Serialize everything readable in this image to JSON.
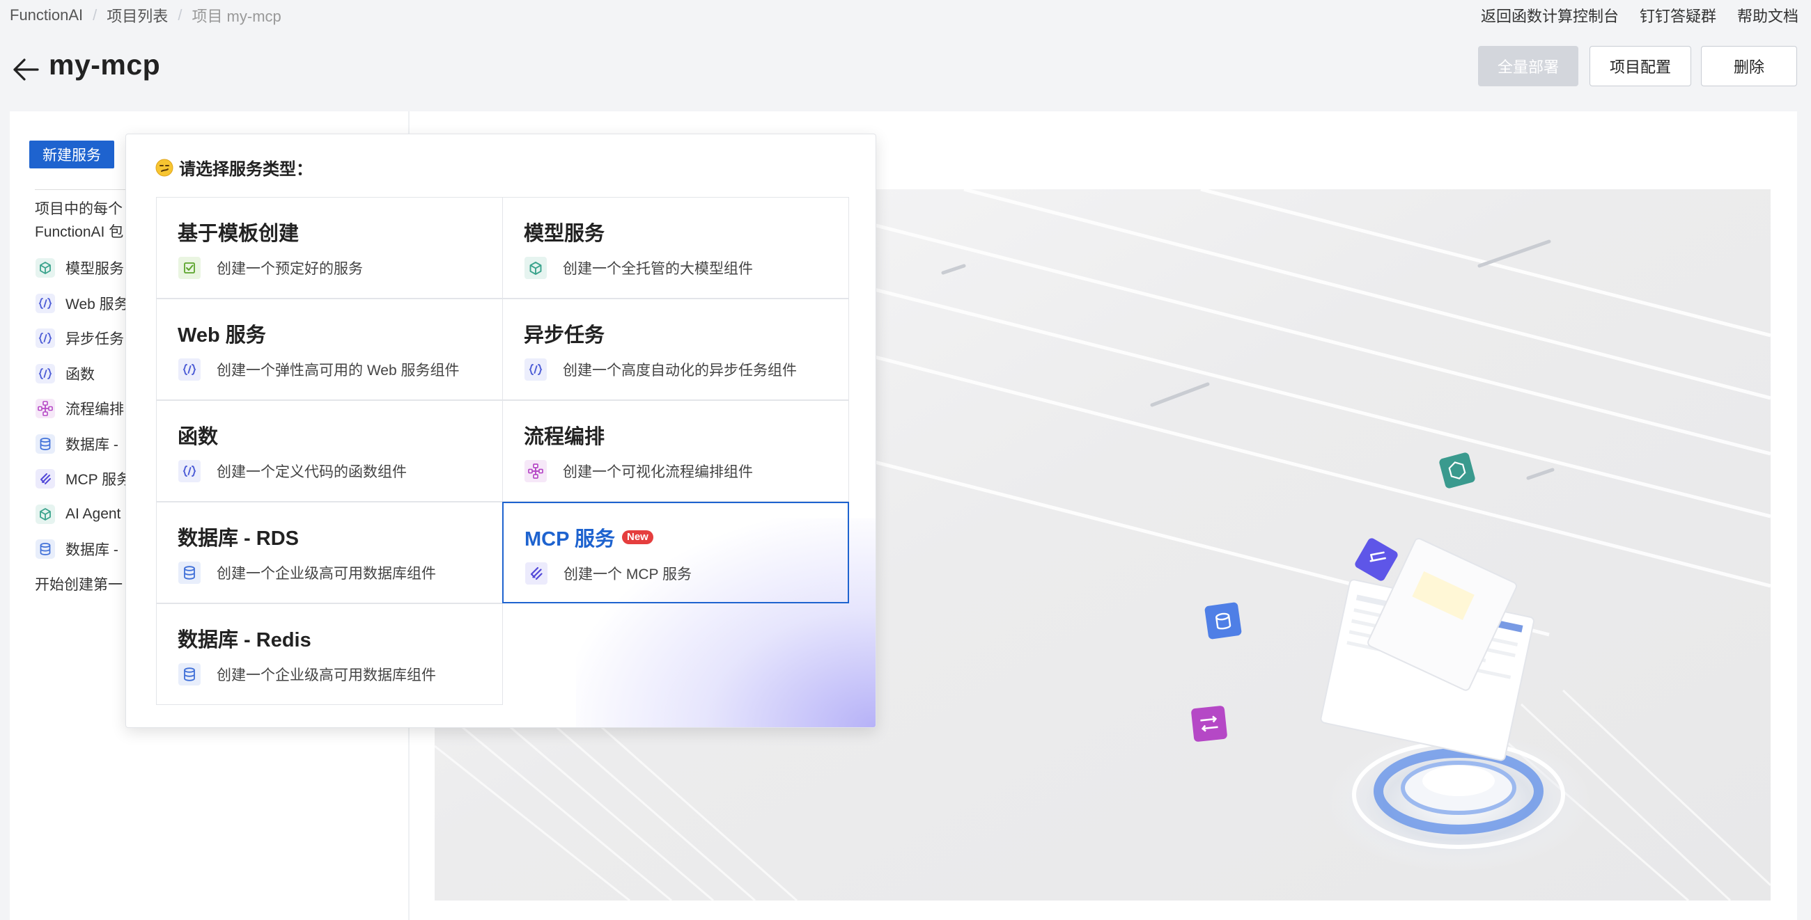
{
  "breadcrumb": {
    "root": "FunctionAI",
    "list": "项目列表",
    "current": "项目 my-mcp"
  },
  "top_links": {
    "console": "返回函数计算控制台",
    "dingtalk": "钉钉答疑群",
    "docs": "帮助文档"
  },
  "header": {
    "title": "my-mcp",
    "deploy_label": "全量部署",
    "config_label": "项目配置",
    "delete_label": "删除"
  },
  "sidebar": {
    "new_service_label": "新建服务",
    "intro_line1": "项目中的每个",
    "intro_line2": "FunctionAI 包",
    "items": [
      {
        "label": "模型服务",
        "icon": "cube-icon"
      },
      {
        "label": "Web 服务",
        "icon": "code-bracket-icon"
      },
      {
        "label": "异步任务",
        "icon": "code-bracket-icon"
      },
      {
        "label": "函数",
        "icon": "code-bracket-icon"
      },
      {
        "label": "流程编排",
        "icon": "workflow-icon"
      },
      {
        "label": "数据库 -",
        "icon": "database-icon"
      },
      {
        "label": "MCP 服务",
        "icon": "mcp-icon"
      },
      {
        "label": "AI Agent",
        "icon": "cube-icon"
      },
      {
        "label": "数据库 -",
        "icon": "database-icon"
      }
    ],
    "start_tip": "开始创建第一"
  },
  "dropdown": {
    "title": "请选择服务类型：",
    "cards": [
      {
        "title": "基于模板创建",
        "desc": "创建一个预定好的服务",
        "icon": "template-check-icon"
      },
      {
        "title": "模型服务",
        "desc": "创建一个全托管的大模型组件",
        "icon": "cube-icon"
      },
      {
        "title": "Web 服务",
        "desc": "创建一个弹性高可用的 Web 服务组件",
        "icon": "code-bracket-icon"
      },
      {
        "title": "异步任务",
        "desc": "创建一个高度自动化的异步任务组件",
        "icon": "code-bracket-icon"
      },
      {
        "title": "函数",
        "desc": "创建一个定义代码的函数组件",
        "icon": "code-bracket-icon"
      },
      {
        "title": "流程编排",
        "desc": "创建一个可视化流程编排组件",
        "icon": "workflow-icon"
      },
      {
        "title": "数据库 - RDS",
        "desc": "创建一个企业级高可用数据库组件",
        "icon": "database-icon"
      },
      {
        "title": "MCP 服务",
        "desc": "创建一个 MCP 服务",
        "icon": "mcp-icon",
        "badge": "New",
        "selected": true
      },
      {
        "title": "数据库 - Redis",
        "desc": "创建一个企业级高可用数据库组件",
        "icon": "database-icon"
      }
    ]
  },
  "colors": {
    "primary": "#1e63cf",
    "badge": "#e53e3e",
    "deploy_disabled": "#d3d6dc",
    "cube_teal": "#3aa38c",
    "code_blue": "#4b5bd6",
    "workflow_purple": "#b548c6",
    "template_green": "#5ba42b"
  }
}
